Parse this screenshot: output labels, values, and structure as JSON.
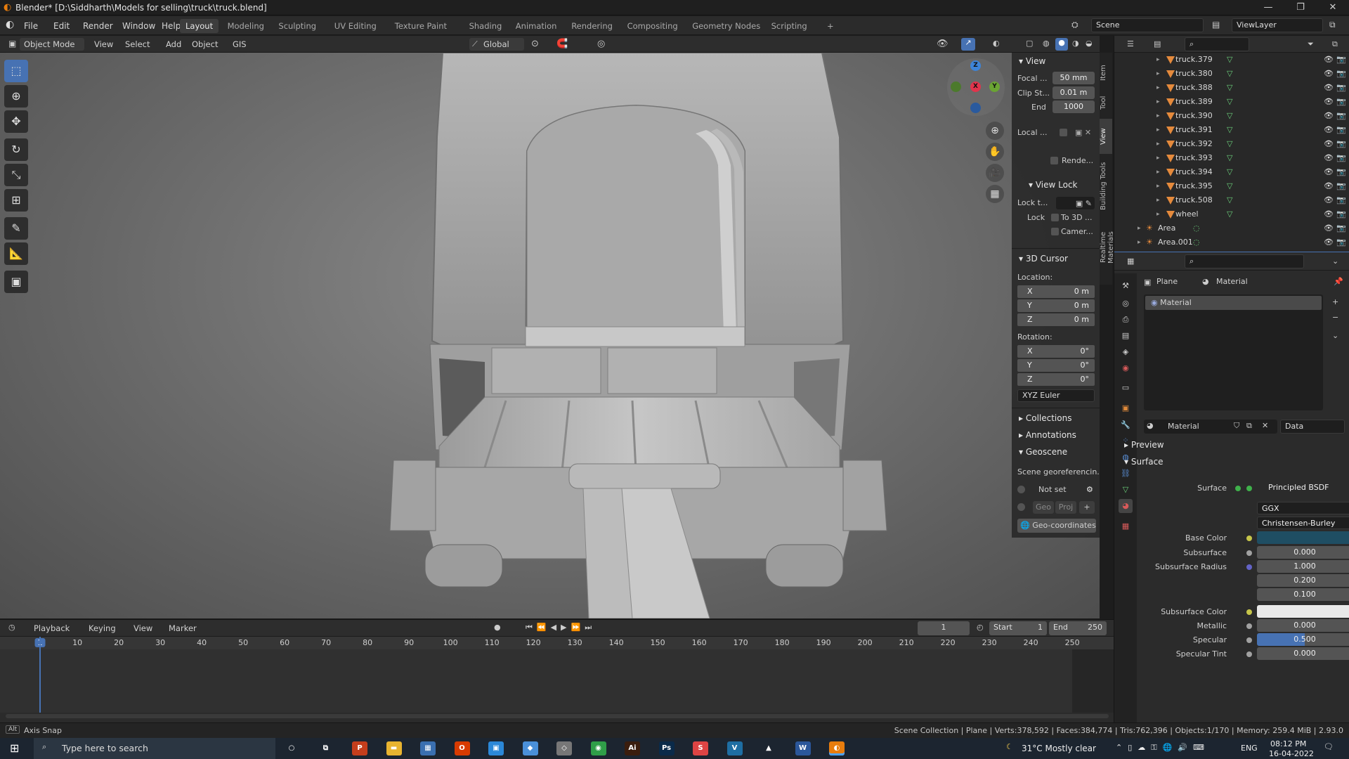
{
  "window": {
    "title": "Blender* [D:\\Siddharth\\Models for selling\\truck\\truck.blend]",
    "minimize": "—",
    "maximize": "❐",
    "close": "✕"
  },
  "menus": [
    "File",
    "Edit",
    "Render",
    "Window",
    "Help"
  ],
  "workspaces": [
    "Layout",
    "Modeling",
    "Sculpting",
    "UV Editing",
    "Texture Paint",
    "Shading",
    "Animation",
    "Rendering",
    "Compositing",
    "Geometry Nodes",
    "Scripting",
    "+"
  ],
  "active_workspace": "Layout",
  "scene": {
    "label": "Scene",
    "view_layer": "ViewLayer"
  },
  "viewport_header": {
    "mode": "Object Mode",
    "menus": [
      "View",
      "Select",
      "Add",
      "Object",
      "GIS"
    ],
    "orientation": "Global"
  },
  "tools": [
    {
      "name": "select-box-icon",
      "glyph": "⬚"
    },
    {
      "name": "cursor-icon",
      "glyph": "⊕"
    },
    {
      "name": "move-icon",
      "glyph": "✥"
    },
    {
      "name": "rotate-icon",
      "glyph": "↻"
    },
    {
      "name": "scale-icon",
      "glyph": "⤡"
    },
    {
      "name": "transform-icon",
      "glyph": "⊞"
    },
    {
      "name": "annotate-icon",
      "glyph": "✎"
    },
    {
      "name": "measure-icon",
      "glyph": "📐"
    },
    {
      "name": "add-cube-icon",
      "glyph": "▣"
    }
  ],
  "gizmo": {
    "x": "X",
    "y": "Y",
    "z": "Z"
  },
  "npanel": {
    "tabs": [
      "Item",
      "Tool",
      "View",
      "Building Tools",
      "Realtime Materials"
    ],
    "view_header": "View",
    "focal_label": "Focal ...",
    "focal_value": "50 mm",
    "clip_start_label": "Clip St...",
    "clip_start_value": "0.01 m",
    "end_label": "End",
    "end_value": "1000",
    "local_label": "Local ...",
    "render_label": "Rende...",
    "view_lock_header": "View Lock",
    "lock_to_label": "Lock t...",
    "lock_label": "Lock",
    "to_3d_label": "To 3D ...",
    "camera_label": "Camer...",
    "cursor_header": "3D Cursor",
    "location_label": "Location:",
    "loc": [
      {
        "axis": "X",
        "value": "0 m"
      },
      {
        "axis": "Y",
        "value": "0 m"
      },
      {
        "axis": "Z",
        "value": "0 m"
      }
    ],
    "rotation_label": "Rotation:",
    "rot": [
      {
        "axis": "X",
        "value": "0°"
      },
      {
        "axis": "Y",
        "value": "0°"
      },
      {
        "axis": "Z",
        "value": "0°"
      }
    ],
    "rotation_mode": "XYZ Euler",
    "collections": "Collections",
    "annotations": "Annotations",
    "geoscene": "Geoscene",
    "scene_geo": "Scene georeferencin...",
    "not_set": "Not set",
    "geo_btn": "Geo",
    "proj_btn": "Proj",
    "geo_coords": "Geo-coordinates"
  },
  "outliner": {
    "items": [
      {
        "label": "truck.379",
        "type": "mesh"
      },
      {
        "label": "truck.380",
        "type": "mesh"
      },
      {
        "label": "truck.388",
        "type": "mesh"
      },
      {
        "label": "truck.389",
        "type": "mesh"
      },
      {
        "label": "truck.390",
        "type": "mesh"
      },
      {
        "label": "truck.391",
        "type": "mesh"
      },
      {
        "label": "truck.392",
        "type": "mesh"
      },
      {
        "label": "truck.393",
        "type": "mesh"
      },
      {
        "label": "truck.394",
        "type": "mesh"
      },
      {
        "label": "truck.395",
        "type": "mesh"
      },
      {
        "label": "truck.508",
        "type": "mesh"
      },
      {
        "label": "wheel",
        "type": "mesh"
      },
      {
        "label": "Area",
        "type": "light"
      },
      {
        "label": "Area.001",
        "type": "light"
      }
    ]
  },
  "properties": {
    "breadcrumb_object": "Plane",
    "breadcrumb_material": "Material",
    "slot": "Material",
    "material_name": "Material",
    "link": "Data",
    "preview": "Preview",
    "surface_header": "Surface",
    "rows": [
      {
        "label": "Surface",
        "value": "Principled BSDF",
        "dot": "#3fb14b"
      },
      {
        "label": "",
        "value": "GGX",
        "dot": ""
      },
      {
        "label": "",
        "value": "Christensen-Burley",
        "dot": ""
      },
      {
        "label": "Base Color",
        "value": "",
        "dot": "#c7c64a",
        "swatch": "#1f4e63"
      },
      {
        "label": "Subsurface",
        "value": "0.000",
        "dot": "#a1a1a1"
      },
      {
        "label": "Subsurface Radius",
        "value": "1.000",
        "dot": "#6363c7"
      },
      {
        "label": "",
        "value": "0.200",
        "dot": ""
      },
      {
        "label": "",
        "value": "0.100",
        "dot": ""
      },
      {
        "label": "Subsurface Color",
        "value": "",
        "dot": "#c7c64a",
        "swatch": "#e8e8e8"
      },
      {
        "label": "Metallic",
        "value": "0.000",
        "dot": "#a1a1a1"
      },
      {
        "label": "Specular",
        "value": "0.500",
        "dot": "#a1a1a1",
        "fill": 0.5
      },
      {
        "label": "Specular Tint",
        "value": "0.000",
        "dot": "#a1a1a1"
      }
    ]
  },
  "timeline": {
    "menus": [
      "Playback",
      "Keying",
      "View",
      "Marker"
    ],
    "current_frame": "1",
    "start_label": "Start",
    "start": "1",
    "end_label": "End",
    "end": "250",
    "ticks": [
      "1",
      "10",
      "20",
      "30",
      "40",
      "50",
      "60",
      "70",
      "80",
      "90",
      "100",
      "110",
      "120",
      "130",
      "140",
      "150",
      "160",
      "170",
      "180",
      "190",
      "200",
      "210",
      "220",
      "230",
      "240",
      "250"
    ]
  },
  "statusbar": {
    "left": "Axis Snap",
    "right": "Scene Collection | Plane | Verts:378,592 | Faces:384,774 | Tris:762,396 | Objects:1/170 | Memory: 259.4 MiB | 2.93.0"
  },
  "taskbar": {
    "search_placeholder": "Type here to search",
    "weather": "31°C  Mostly clear",
    "lang": "ENG",
    "time": "08:12 PM",
    "date": "16-04-2022",
    "apps": [
      {
        "name": "cortana-icon",
        "glyph": "○",
        "color": "transparent"
      },
      {
        "name": "task-view-icon",
        "glyph": "⧉",
        "color": "transparent"
      },
      {
        "name": "powerpoint-icon",
        "glyph": "P",
        "color": "#c43e1c"
      },
      {
        "name": "file-explorer-icon",
        "glyph": "▬",
        "color": "#e8b430"
      },
      {
        "name": "store-icon",
        "glyph": "▦",
        "color": "#3a6fb0"
      },
      {
        "name": "office-icon",
        "glyph": "O",
        "color": "#d83b01"
      },
      {
        "name": "photos-icon",
        "glyph": "▣",
        "color": "#2b88d8"
      },
      {
        "name": "app-icon",
        "glyph": "◆",
        "color": "#4a90d9"
      },
      {
        "name": "app2-icon",
        "glyph": "◇",
        "color": "#777"
      },
      {
        "name": "chrome-icon",
        "glyph": "◉",
        "color": "#2f9e48"
      },
      {
        "name": "illustrator-icon",
        "glyph": "Ai",
        "color": "#3a1d0e"
      },
      {
        "name": "photoshop-icon",
        "glyph": "Ps",
        "color": "#0a2a49"
      },
      {
        "name": "sketchup-icon",
        "glyph": "S",
        "color": "#d44"
      },
      {
        "name": "v-ray-icon",
        "glyph": "V",
        "color": "#1e6ea3"
      },
      {
        "name": "vlc-icon",
        "glyph": "▲",
        "color": "transparent"
      },
      {
        "name": "word-icon",
        "glyph": "W",
        "color": "#2b579a"
      },
      {
        "name": "blender-icon",
        "glyph": "◐",
        "color": "#e87d0d"
      }
    ]
  }
}
